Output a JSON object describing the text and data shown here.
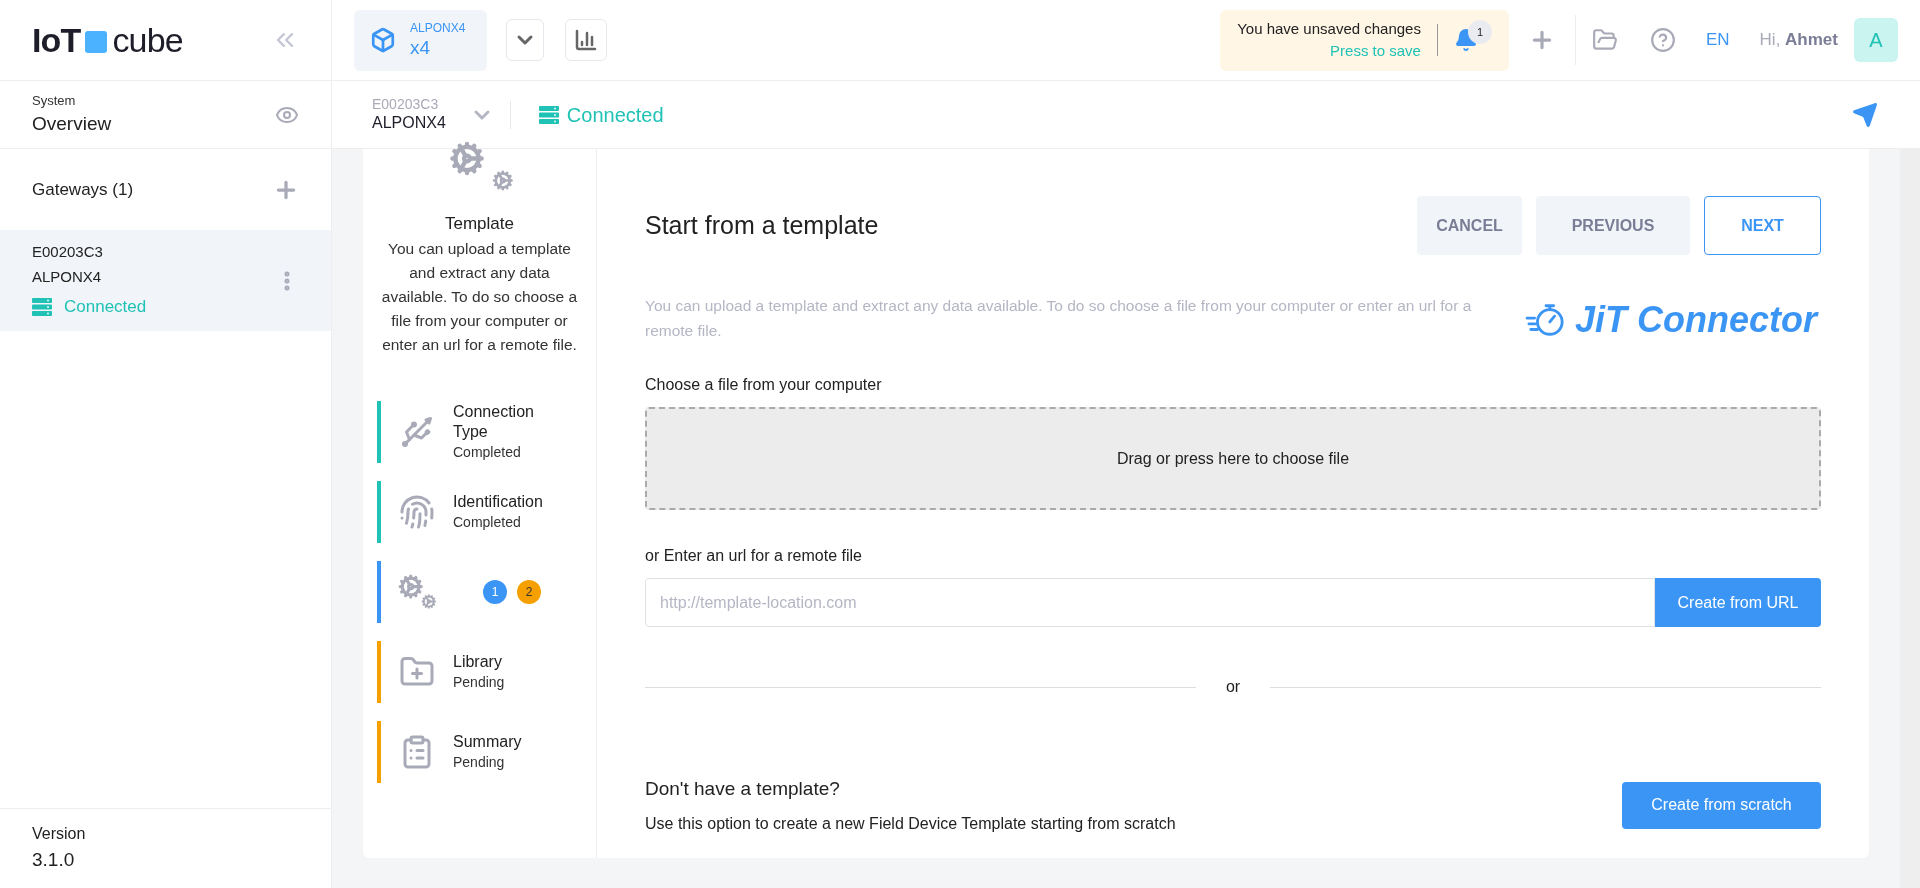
{
  "logo": {
    "part_1": "IoT",
    "part_2": "cube"
  },
  "sidebar": {
    "overview": {
      "label": "System",
      "title": "Overview"
    },
    "gateways": {
      "title": "Gateways (1)"
    },
    "items": [
      {
        "id_text": "E00203C3",
        "name": "ALPONX4",
        "status": "Connected",
        "selected": true
      }
    ],
    "version": {
      "label": "Version",
      "value": "3.1.0"
    }
  },
  "topbar": {
    "device": {
      "name": "ALPONX4",
      "count": "x4"
    },
    "unsaved": {
      "message": "You have unsaved changes",
      "action": "Press to save"
    },
    "notifications": "1",
    "language": "EN",
    "greeting": "Hi,",
    "user": "Ahmet",
    "avatar": "A"
  },
  "subbar": {
    "id_text": "E00203C3",
    "name": "ALPONX4",
    "status": "Connected"
  },
  "wizard": {
    "intro": {
      "title": "Template",
      "text": "You can upload a template and extract any data available. To do so choose a file from your computer or enter an url for a remote file."
    },
    "steps": [
      {
        "kind": "usb",
        "title": "Connection Type",
        "status_text": "Completed",
        "color": "#1fc2b5"
      },
      {
        "kind": "fingerprint",
        "title": "Identification",
        "status_text": "Completed",
        "color": "#1fc2b5"
      },
      {
        "kind": "gears",
        "color": "#3b95f5",
        "badges": [
          {
            "text": "1",
            "color": "#3b95f5"
          },
          {
            "text": "2",
            "color": "#f5a000"
          }
        ]
      },
      {
        "kind": "folder",
        "title": "Library",
        "status_text": "Pending",
        "color": "#f5a000"
      },
      {
        "kind": "clipboard",
        "title": "Summary",
        "status_text": "Pending",
        "color": "#f5a000"
      }
    ]
  },
  "main": {
    "title": "Start from a template",
    "buttons": [
      {
        "label": "CANCEL",
        "kind": "secondary"
      },
      {
        "label": "PREVIOUS",
        "kind": "secondary"
      },
      {
        "label": "NEXT",
        "kind": "outline"
      }
    ],
    "description": "You can upload a template and extract any data available. To do so choose a file from your computer or enter an url for a remote file.",
    "brand": "JiT Connector",
    "file_label": "Choose a file from your computer",
    "dropzone": "Drag or press here to choose file",
    "url_label": "or Enter an url for a remote file",
    "url_placeholder": "http://template-location.com",
    "url_button": "Create from URL",
    "divider": "or",
    "scratch": {
      "title": "Don't have a template?",
      "text": "Use this option to create a new Field Device Template starting from scratch",
      "button": "Create from scratch"
    }
  }
}
